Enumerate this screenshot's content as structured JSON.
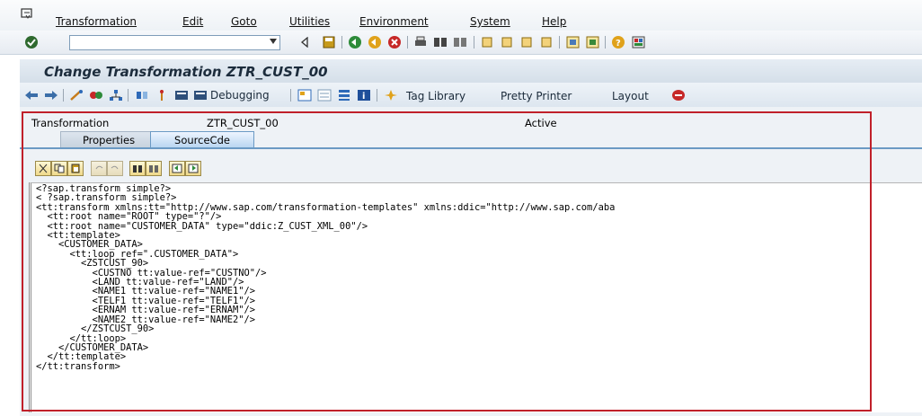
{
  "menubar": {
    "items": [
      "Transformation",
      "Edit",
      "Goto",
      "Utilities",
      "Environment",
      "System",
      "Help"
    ]
  },
  "std_toolbar": {
    "command_field": {
      "value": "",
      "placeholder": ""
    }
  },
  "title": "Change Transformation ZTR_CUST_00",
  "app_toolbar": {
    "debugging_label": "Debugging",
    "tag_library_label": "Tag Library",
    "pretty_printer_label": "Pretty Printer",
    "layout_label": "Layout"
  },
  "header": {
    "field_label": "Transformation",
    "name": "ZTR_CUST_00",
    "status": "Active"
  },
  "tabs": [
    "Properties",
    "SourceCde"
  ],
  "source_code": [
    "<?sap.transform simple?>",
    "< ?sap.transform simple?>",
    "<tt:transform xmlns:tt=\"http://www.sap.com/transformation-templates\" xmlns:ddic=\"http://www.sap.com/aba",
    "  <tt:root name=\"ROOT\" type=\"?\"/>",
    "  <tt:root name=\"CUSTOMER_DATA\" type=\"ddic:Z_CUST_XML_00\"/>",
    "  <tt:template>",
    "    <CUSTOMER_DATA>",
    "      <tt:loop ref=\".CUSTOMER_DATA\">",
    "        <ZSTCUST_90>",
    "          <CUSTNO tt:value-ref=\"CUSTNO\"/>",
    "          <LAND tt:value-ref=\"LAND\"/>",
    "          <NAME1 tt:value-ref=\"NAME1\"/>",
    "          <TELF1 tt:value-ref=\"TELF1\"/>",
    "          <ERNAM tt:value-ref=\"ERNAM\"/>",
    "          <NAME2 tt:value-ref=\"NAME2\"/>",
    "        </ZSTCUST_90>",
    "      </tt:loop>",
    "    </CUSTOMER_DATA>",
    "  </tt:template>",
    "</tt:transform>"
  ],
  "colors": {
    "highlight_border": "#c0202a",
    "title_bg": "#d5dfe9",
    "tab_active": "#b9d6f1"
  }
}
